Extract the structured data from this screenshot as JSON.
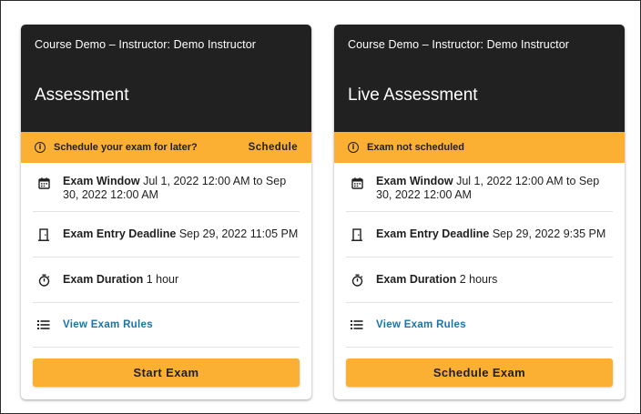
{
  "cards": [
    {
      "course": "Course Demo – Instructor: Demo Instructor",
      "title": "Assessment",
      "banner": {
        "text": "Schedule your exam for later?",
        "action": "Schedule"
      },
      "window": {
        "label": "Exam Window",
        "value": "Jul 1, 2022 12:00 AM to Sep 30, 2022 12:00 AM"
      },
      "deadline": {
        "label": "Exam Entry Deadline",
        "value": "Sep 29, 2022 11:05 PM"
      },
      "duration": {
        "label": "Exam Duration",
        "value": "1 hour"
      },
      "rules_link": "View Exam Rules",
      "button": "Start Exam"
    },
    {
      "course": "Course Demo – Instructor: Demo Instructor",
      "title": "Live Assessment",
      "banner": {
        "text": "Exam not scheduled",
        "action": ""
      },
      "window": {
        "label": "Exam Window",
        "value": "Jul 1, 2022 12:00 AM to Sep 30, 2022 12:00 AM"
      },
      "deadline": {
        "label": "Exam Entry Deadline",
        "value": "Sep 29, 2022 9:35 PM"
      },
      "duration": {
        "label": "Exam Duration",
        "value": "2 hours"
      },
      "rules_link": "View Exam Rules",
      "button": "Schedule Exam"
    }
  ],
  "icons": {
    "info": "info-icon",
    "window": "calendar-icon",
    "deadline": "door-icon",
    "duration": "stopwatch-icon",
    "rules": "list-icon"
  },
  "colors": {
    "header_bg": "#212121",
    "accent": "#fbb034",
    "link": "#1a73a8"
  }
}
